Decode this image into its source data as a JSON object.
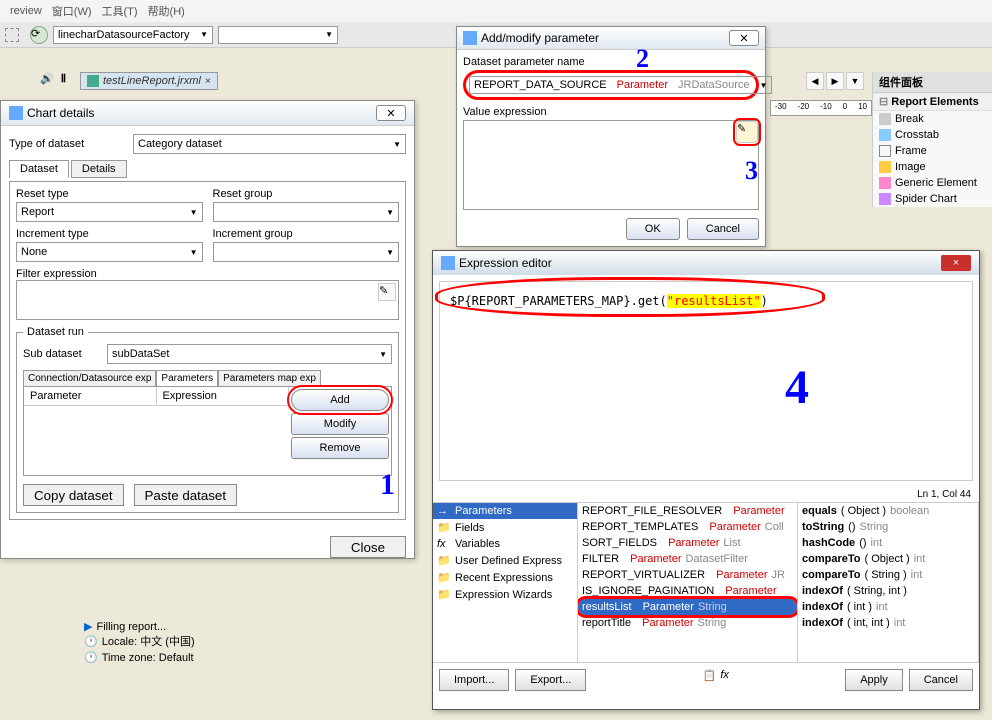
{
  "menubar": [
    "窗口(W)",
    "工具(T)",
    "帮助(H)"
  ],
  "toolbar": {
    "datasource": "linecharDatasourceFactory"
  },
  "fileTab": "testLineReport.jrxml",
  "chartDetails": {
    "title": "Chart details",
    "typeLabel": "Type of dataset",
    "typeValue": "Category dataset",
    "mainTabs": [
      "Dataset",
      "Details"
    ],
    "resetTypeLabel": "Reset type",
    "resetTypeValue": "Report",
    "resetGroupLabel": "Reset group",
    "incrementTypeLabel": "Increment type",
    "incrementTypeValue": "None",
    "incrementGroupLabel": "Increment group",
    "filterLabel": "Filter expression",
    "datasetRunLabel": "Dataset run",
    "subDatasetLabel": "Sub dataset",
    "subDatasetValue": "subDataSet",
    "paramTabs": [
      "Connection/Datasource exp",
      "Parameters",
      "Parameters map exp"
    ],
    "paramCols": [
      "Parameter",
      "Expression"
    ],
    "buttons": {
      "add": "Add",
      "modify": "Modify",
      "remove": "Remove",
      "copy": "Copy dataset",
      "paste": "Paste dataset",
      "close": "Close"
    }
  },
  "addParam": {
    "title": "Add/modify parameter",
    "nameLabel": "Dataset parameter name",
    "paramName": "REPORT_DATA_SOURCE",
    "paramType": "Parameter",
    "paramClass": "JRDataSource",
    "valueLabel": "Value expression",
    "ok": "OK",
    "cancel": "Cancel"
  },
  "exprEditor": {
    "title": "Expression editor",
    "code_prefix": "$P{REPORT_PARAMETERS_MAP}",
    "code_method": ".get(",
    "code_arg": "\"resultsList\"",
    "code_end": ")",
    "status": "Ln 1, Col 44",
    "leftPanel": [
      {
        "icon": "→",
        "label": "Parameters",
        "selected": true
      },
      {
        "icon": "📁",
        "label": "Fields"
      },
      {
        "icon": "fx",
        "label": "Variables"
      },
      {
        "icon": "📁",
        "label": "User Defined Express"
      },
      {
        "icon": "📁",
        "label": "Recent Expressions"
      },
      {
        "icon": "📁",
        "label": "Expression Wizards"
      }
    ],
    "middlePanel": [
      {
        "name": "REPORT_FILE_RESOLVER",
        "type": "Parameter",
        "cls": ""
      },
      {
        "name": "REPORT_TEMPLATES",
        "type": "Parameter",
        "cls": "Coll"
      },
      {
        "name": "SORT_FIELDS",
        "type": "Parameter",
        "cls": "List"
      },
      {
        "name": "FILTER",
        "type": "Parameter",
        "cls": "DatasetFilter"
      },
      {
        "name": "REPORT_VIRTUALIZER",
        "type": "Parameter",
        "cls": "JR"
      },
      {
        "name": "IS_IGNORE_PAGINATION",
        "type": "Parameter",
        "cls": ""
      },
      {
        "name": "resultsList",
        "type": "Parameter",
        "cls": "String",
        "selected": true,
        "highlighted": true
      },
      {
        "name": "reportTitle",
        "type": "Parameter",
        "cls": "String"
      }
    ],
    "rightPanel": [
      "equals( Object ) boolean",
      "toString() String",
      "hashCode() int",
      "compareTo( Object ) int",
      "compareTo( String ) int",
      "indexOf( String, int )",
      "indexOf( int ) int",
      "indexOf( int, int ) int"
    ],
    "footer": {
      "import": "Import...",
      "export": "Export...",
      "apply": "Apply",
      "cancel": "Cancel"
    }
  },
  "palette": {
    "header": "组件面板",
    "section": "Report Elements",
    "items": [
      "Break",
      "Crosstab",
      "Frame",
      "Image",
      "Generic Element",
      "Spider Chart"
    ]
  },
  "rulerTicks": [
    "-30",
    "-20",
    "-10",
    "0",
    "10"
  ],
  "reportStatus": {
    "filling": "Filling report...",
    "locale": "Locale: 中文 (中国)",
    "timezone": "Time zone: Default"
  },
  "annotations": {
    "two": "2",
    "three": "3",
    "four": "4",
    "one": "1"
  }
}
